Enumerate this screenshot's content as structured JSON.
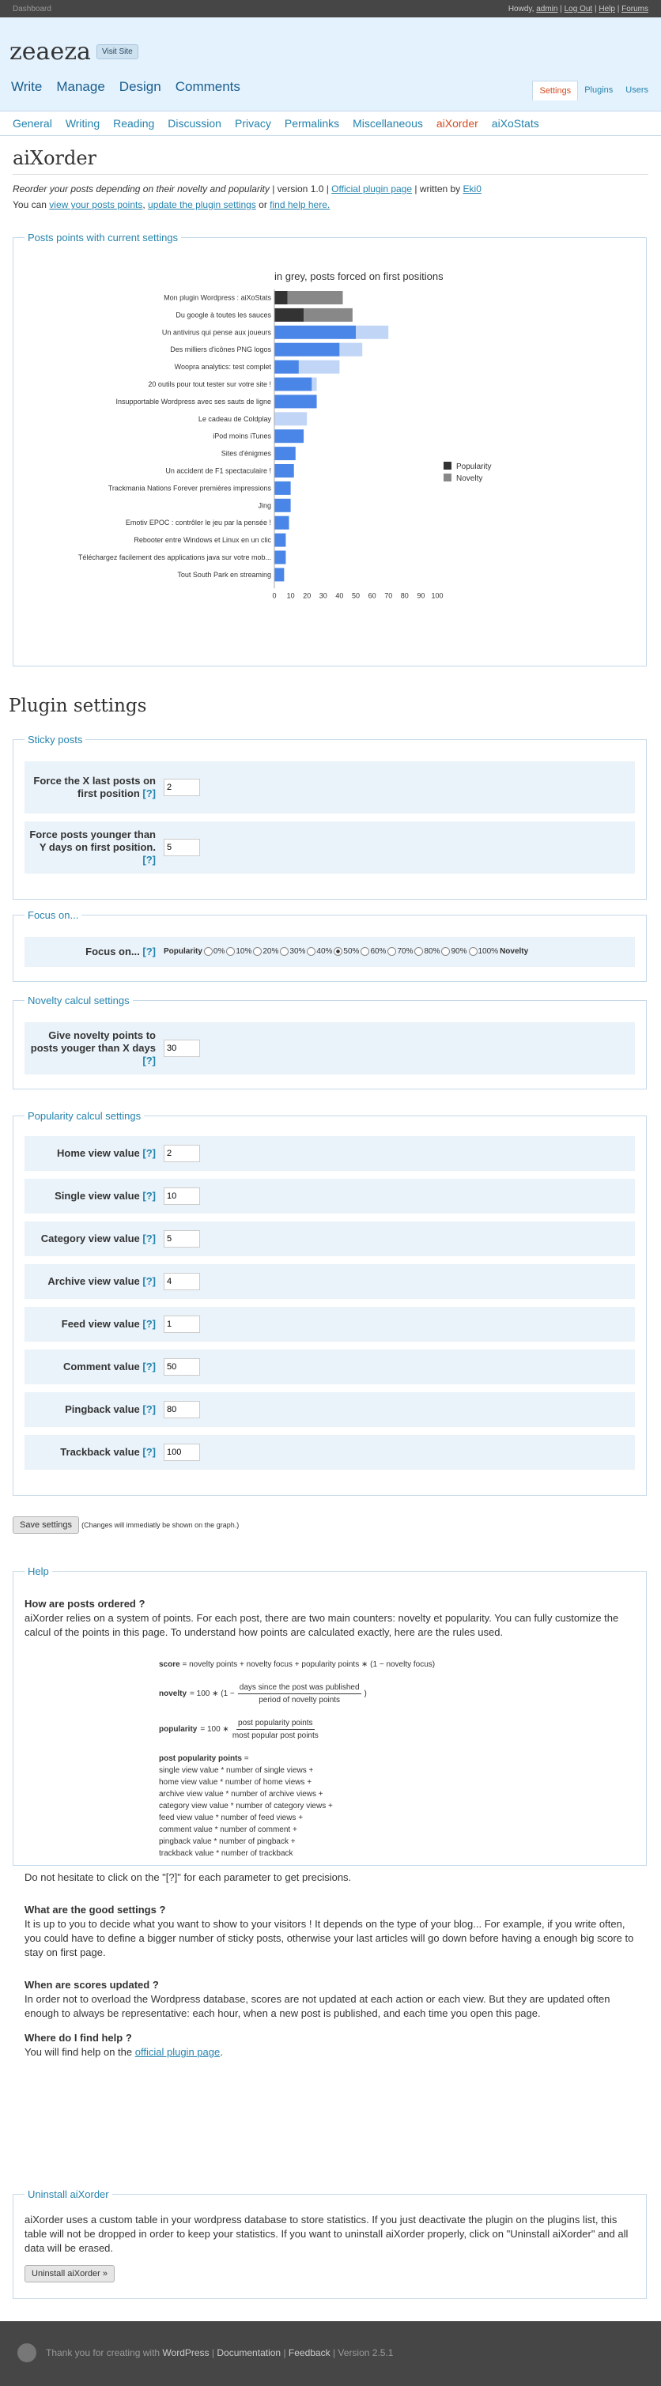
{
  "topbar": {
    "dashboard": "Dashboard",
    "howdy": "Howdy,",
    "user": "admin",
    "logout": "Log Out",
    "help": "Help",
    "forums": "Forums"
  },
  "site": {
    "title": "zeaeza",
    "visit": "Visit Site"
  },
  "mainnav": [
    "Write",
    "Manage",
    "Design",
    "Comments"
  ],
  "sidenav": [
    "Settings",
    "Plugins",
    "Users"
  ],
  "subnav": [
    "General",
    "Writing",
    "Reading",
    "Discussion",
    "Privacy",
    "Permalinks",
    "Miscellaneous",
    "aiXorder",
    "aiXoStats"
  ],
  "page": {
    "title": "aiXorder",
    "desc": "Reorder your posts depending on their novelty and popularity",
    "version": "| version 1.0 |",
    "official": "Official plugin page",
    "writtenby": "| written by",
    "author": "Eki0",
    "youcan": "You can",
    "link1": "view your posts points",
    "comma": ",",
    "link2": "update the plugin settings",
    "or": "or",
    "link3": "find help here."
  },
  "chart_section": {
    "legend": "Posts points with current settings"
  },
  "chart_data": {
    "type": "bar",
    "title": "in grey, posts forced on first positions",
    "orientation": "horizontal",
    "stacked": true,
    "categories": [
      "Mon plugin Wordpress : aiXoStats",
      "Du google à toutes les sauces",
      "Un antivirus qui pense aux joueurs",
      "Des milliers d'icônes  PNG  logos",
      "Woopra analytics: test complet",
      "20 outils pour tout tester sur votre site !",
      "Insupportable Wordpress avec ses sauts de ligne",
      "Le  cadeau  de Coldplay",
      "iPod moins iTunes",
      "Sites d'énigmes",
      "Un accident de F1 spectaculaire !",
      "Trackmania Nations Forever  premières impressions",
      "Jing",
      "Emotiv EPOC : contrôler le jeu par la pensée !",
      "Rebooter entre Windows et Linux en un clic",
      "Téléchargez facilement des applications java sur votre mob...",
      "Tout South Park en streaming"
    ],
    "series": [
      {
        "name": "Popularity",
        "values": [
          8,
          18,
          50,
          40,
          15,
          23,
          26,
          0,
          18,
          13,
          12,
          10,
          10,
          9,
          7,
          7,
          6
        ],
        "forced_color": "#333333",
        "color": "#4a86e8"
      },
      {
        "name": "Novelty",
        "values": [
          34,
          30,
          20,
          14,
          25,
          3,
          0,
          20,
          0,
          0,
          0,
          0,
          0,
          0,
          0,
          0,
          0
        ],
        "forced_color": "#888888",
        "color": "#c1d6f7"
      }
    ],
    "forced_count": 2,
    "xticks": [
      0,
      10,
      20,
      30,
      40,
      50,
      60,
      70,
      80,
      90,
      100
    ],
    "xlim": [
      0,
      100
    ],
    "legend_position": "right"
  },
  "plugin_settings_title": "Plugin settings",
  "sticky": {
    "legend": "Sticky posts",
    "rows": [
      {
        "label": "Force the X last posts on first position",
        "help": "[?]",
        "value": "2"
      },
      {
        "label": "Force posts younger than Y days on first position.",
        "help": "[?]",
        "value": "5"
      }
    ]
  },
  "focus": {
    "legend": "Focus on...",
    "label": "Focus on...",
    "help": "[?]",
    "left": "Popularity",
    "right": "Novelty",
    "options": [
      "0%",
      "10%",
      "20%",
      "30%",
      "40%",
      "50%",
      "60%",
      "70%",
      "80%",
      "90%",
      "100%"
    ],
    "selected": "50%"
  },
  "novelty": {
    "legend": "Novelty calcul settings",
    "rows": [
      {
        "label": "Give novelty points to posts youger than X days",
        "help": "[?]",
        "value": "30"
      }
    ]
  },
  "popularity": {
    "legend": "Popularity calcul settings",
    "rows": [
      {
        "label": "Home view value",
        "help": "[?]",
        "value": "2"
      },
      {
        "label": "Single view value",
        "help": "[?]",
        "value": "10"
      },
      {
        "label": "Category view value",
        "help": "[?]",
        "value": "5"
      },
      {
        "label": "Archive view value",
        "help": "[?]",
        "value": "4"
      },
      {
        "label": "Feed view value",
        "help": "[?]",
        "value": "1"
      },
      {
        "label": "Comment value",
        "help": "[?]",
        "value": "50"
      },
      {
        "label": "Pingback value",
        "help": "[?]",
        "value": "80"
      },
      {
        "label": "Trackback value",
        "help": "[?]",
        "value": "100"
      }
    ]
  },
  "save": {
    "button": "Save settings",
    "note": "(Changes will immediatly be shown on the graph.)"
  },
  "help": {
    "legend": "Help",
    "q1": "How are posts ordered ?",
    "a1": "aiXorder relies on a system of points. For each post, there are two main counters: novelty et popularity. You can fully customize the calcul of the points in this page. To understand how points are calculated exactly, here are the rules used.",
    "f_score_label": "score",
    "f_score": "= novelty points + novelty focus + popularity points ∗ (1 − novelty focus)",
    "f_novelty_label": "novelty",
    "f_novelty_pre": "= 100 ∗ (1 −",
    "f_novelty_num": "days since the post was published",
    "f_novelty_den": "period of novelty points",
    "f_novelty_post": ")",
    "f_pop_label": "popularity",
    "f_pop_pre": "= 100 ∗",
    "f_pop_num": "post popularity points",
    "f_pop_den": "most popular post points",
    "f_ppp_label": "post popularity points",
    "f_ppp_eq": "=",
    "f_lines": [
      "single view value * number of single views +",
      "home view value * number of home views +",
      "archive view value * number of archive views +",
      "category view value * number of category views +",
      "feed view value * number of feed views +",
      "comment value * number of comment +",
      "pingback value * number of pingback +",
      "trackback value * number of trackback"
    ],
    "hint": "Do not hesitate to click on the \"[?]\" for each parameter to get precisions.",
    "q2": "What are the good settings ?",
    "a2": "It is up to you to decide what you want to show to your visitors ! It depends on the type of your blog... For example, if you write often, you could have to define a bigger number of sticky posts, otherwise your last articles will go down before having a enough big score to stay on first page.",
    "q3": "When are scores updated ?",
    "a3": "In order not to overload the Wordpress database, scores are not updated at each action or each view. But they are updated often enough to always be representative: each hour, when a new post is published, and each time you open this page.",
    "q4": "Where do I find help ?",
    "a4_pre": "You will find help on the",
    "a4_link": "official plugin page",
    "a4_post": "."
  },
  "uninstall": {
    "legend": "Uninstall aiXorder",
    "text": "aiXorder uses a custom table in your wordpress database to store statistics. If you just deactivate the plugin on the plugins list, this table will not be dropped in order to keep your statistics. If you want to uninstall aiXorder properly, click on \"Uninstall aiXorder\" and all data will be erased.",
    "button": "Uninstall aiXorder »"
  },
  "footer": {
    "pre": "Thank you for creating with",
    "wp": "WordPress",
    "sep1": "|",
    "doc": "Documentation",
    "sep2": "|",
    "feedback": "Feedback",
    "sep3": "|",
    "version": "Version 2.5.1"
  }
}
